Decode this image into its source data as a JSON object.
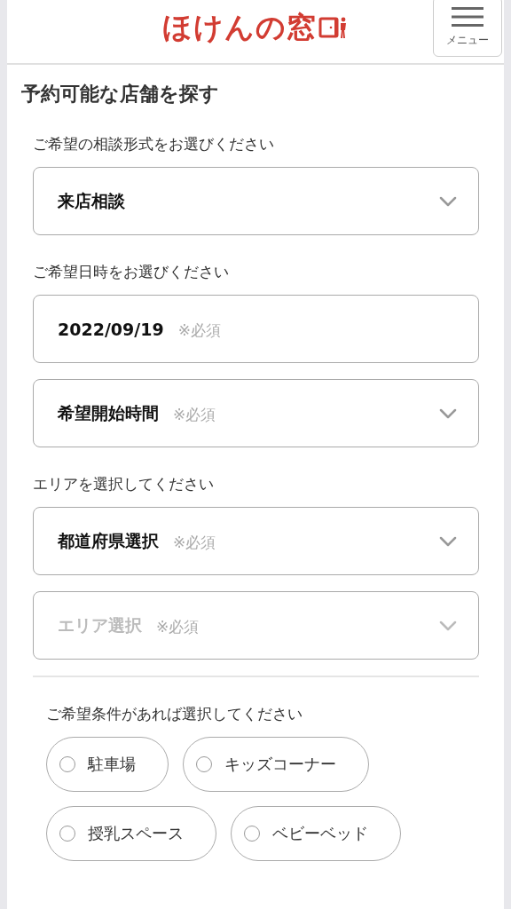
{
  "header": {
    "logo": "ほけんの窓",
    "menu_label": "メニュー"
  },
  "title": "予約可能な店舗を探す",
  "sections": [
    {
      "label": "ご希望の相談形式をお選びください",
      "fields": [
        {
          "kind": "select",
          "value": "来店相談",
          "disabled": false
        }
      ]
    },
    {
      "label": "ご希望日時をお選びください",
      "fields": [
        {
          "kind": "date",
          "value": "2022/09/19",
          "note": "※必須",
          "disabled": false
        },
        {
          "kind": "select",
          "value": "希望開始時間",
          "note": "※必須",
          "disabled": false
        }
      ]
    },
    {
      "label": "エリアを選択してください",
      "fields": [
        {
          "kind": "select",
          "value": "都道府県選択",
          "note": "※必須",
          "disabled": false
        },
        {
          "kind": "select",
          "value": "エリア選択",
          "note": "※必須",
          "disabled": true
        }
      ]
    }
  ],
  "conditions": {
    "label": "ご希望条件があれば選択してください",
    "options": [
      {
        "label": "駐車場",
        "checked": false
      },
      {
        "label": "キッズコーナー",
        "checked": false
      },
      {
        "label": "授乳スペース",
        "checked": false
      },
      {
        "label": "ベビーベッド",
        "checked": false
      }
    ]
  }
}
